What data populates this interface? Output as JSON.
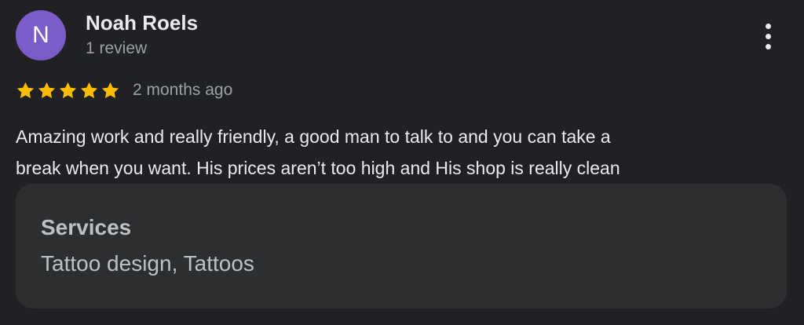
{
  "reviewer": {
    "initial": "N",
    "name": "Noah Roels",
    "review_count": "1 review",
    "avatar_color": "#7b5cc9"
  },
  "rating": {
    "stars": 5,
    "max_stars": 5,
    "star_color": "#fbbc04",
    "date": "2 months ago"
  },
  "review": {
    "text_line_1": "Amazing work and really friendly, a good man to talk to and you can take a",
    "text_line_2": "break when you want. His prices aren’t too high and His shop is really clean"
  },
  "services": {
    "label": "Services",
    "value": "Tattoo design, Tattoos"
  },
  "menu": {
    "icon": "more-vert-icon"
  }
}
